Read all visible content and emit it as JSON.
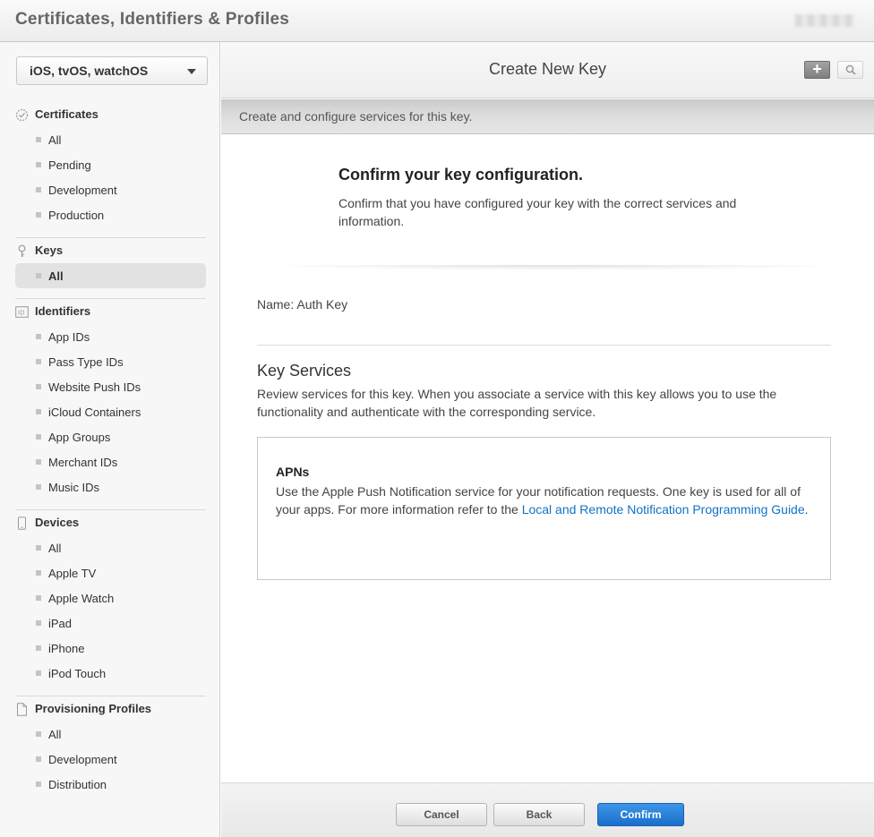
{
  "app": {
    "title": "Certificates, Identifiers & Profiles"
  },
  "sidebar": {
    "platform": "iOS, tvOS, watchOS",
    "sections": {
      "certificates": {
        "title": "Certificates",
        "items": [
          "All",
          "Pending",
          "Development",
          "Production"
        ]
      },
      "keys": {
        "title": "Keys",
        "items": [
          "All"
        ],
        "active": "All"
      },
      "identifiers": {
        "title": "Identifiers",
        "items": [
          "App IDs",
          "Pass Type IDs",
          "Website Push IDs",
          "iCloud Containers",
          "App Groups",
          "Merchant IDs",
          "Music IDs"
        ]
      },
      "devices": {
        "title": "Devices",
        "items": [
          "All",
          "Apple TV",
          "Apple Watch",
          "iPad",
          "iPhone",
          "iPod Touch"
        ]
      },
      "profiles": {
        "title": "Provisioning Profiles",
        "items": [
          "All",
          "Development",
          "Distribution"
        ]
      }
    }
  },
  "header": {
    "title": "Create New Key",
    "subtitle": "Create and configure services for this key."
  },
  "content": {
    "confirm_title": "Confirm your key configuration.",
    "confirm_desc": "Confirm that you have configured your key with the correct services and information.",
    "name_label": "Name:",
    "name_value": "Auth Key",
    "services_title": "Key Services",
    "services_desc": "Review services for this key. When you associate a service with this key allows you to use the functionality and authenticate with the corresponding service.",
    "service": {
      "title": "APNs",
      "desc_before": "Use the Apple Push Notification service for your notification requests. One key is used for all of your apps. For more information refer to the ",
      "link": "Local and Remote Notification Programming Guide",
      "desc_after": "."
    }
  },
  "footer": {
    "cancel": "Cancel",
    "back": "Back",
    "confirm": "Confirm"
  },
  "colors": {
    "accent": "#1b6fcb",
    "link": "#0f73c4"
  }
}
